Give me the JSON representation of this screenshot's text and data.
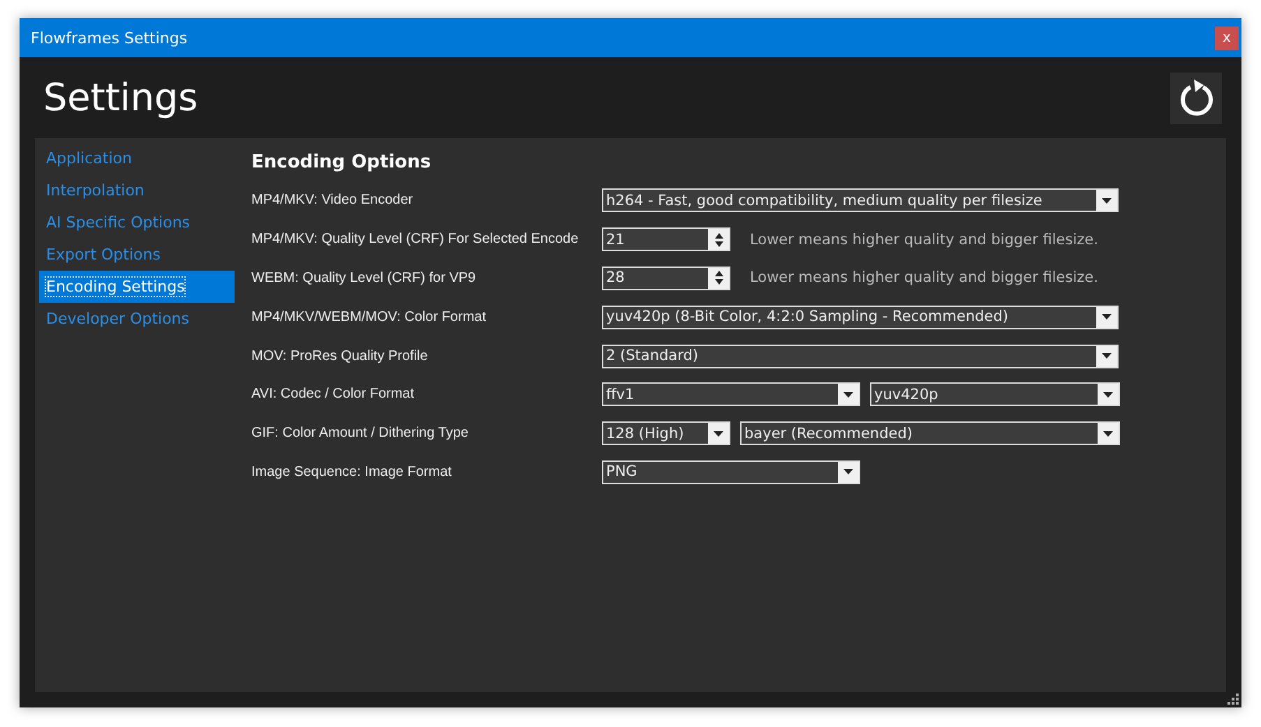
{
  "window": {
    "title": "Flowframes Settings",
    "close": "x"
  },
  "header": {
    "title": "Settings"
  },
  "sidebar": {
    "items": [
      {
        "label": "Application",
        "selected": false
      },
      {
        "label": "Interpolation",
        "selected": false
      },
      {
        "label": "AI Specific Options",
        "selected": false
      },
      {
        "label": "Export Options",
        "selected": false
      },
      {
        "label": "Encoding Settings",
        "selected": true
      },
      {
        "label": "Developer Options",
        "selected": false
      }
    ]
  },
  "section": {
    "title": "Encoding Options",
    "rows": [
      {
        "label": "MP4/MKV: Video Encoder",
        "kind": "select",
        "values": [
          "h264 - Fast, good compatibility, medium quality per filesize"
        ]
      },
      {
        "label": "MP4/MKV: Quality Level (CRF) For Selected Encode",
        "kind": "spinner",
        "values": [
          "21"
        ],
        "hint": "Lower means higher quality and bigger filesize."
      },
      {
        "label": "WEBM: Quality Level (CRF) for VP9",
        "kind": "spinner",
        "values": [
          "28"
        ],
        "hint": "Lower means higher quality and bigger filesize."
      },
      {
        "label": "MP4/MKV/WEBM/MOV: Color Format",
        "kind": "select",
        "values": [
          "yuv420p (8-Bit Color, 4:2:0 Sampling - Recommended)"
        ]
      },
      {
        "label": "MOV: ProRes Quality Profile",
        "kind": "select",
        "values": [
          "2 (Standard)"
        ]
      },
      {
        "label": "AVI: Codec / Color Format",
        "kind": "half-pair",
        "values": [
          "ffv1",
          "yuv420p"
        ]
      },
      {
        "label": "GIF: Color Amount / Dithering Type",
        "kind": "narrow-pair",
        "values": [
          "128 (High)",
          "bayer (Recommended)"
        ]
      },
      {
        "label": "Image Sequence: Image Format",
        "kind": "half-select",
        "values": [
          "PNG"
        ]
      }
    ]
  }
}
